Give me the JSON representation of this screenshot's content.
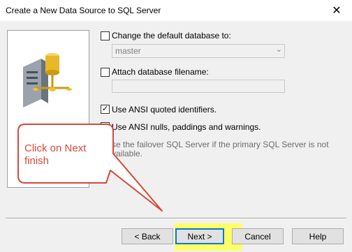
{
  "window": {
    "title": "Create a New Data Source to SQL Server",
    "close_glyph": "✕"
  },
  "options": {
    "change_db": {
      "label": "Change the default database to:",
      "checked": false
    },
    "db_value": "master",
    "attach": {
      "label": "Attach database filename:",
      "checked": false
    },
    "attach_value": "",
    "ansi_quoted": {
      "label": "Use ANSI quoted identifiers.",
      "checked": true
    },
    "ansi_nulls": {
      "label": "Use ANSI nulls, paddings and warnings.",
      "checked": true
    },
    "failover_line1": "se the failover SQL Server if the primary SQL Server is not",
    "failover_line2": "vailable."
  },
  "callout": {
    "line1": "Click on Next",
    "line2": "finish",
    "color": "#d9473a"
  },
  "buttons": {
    "back": "< Back",
    "next": "Next >",
    "cancel": "Cancel",
    "help": "Help"
  },
  "colors": {
    "highlight": "#ffff66",
    "focus": "#0078d7"
  }
}
